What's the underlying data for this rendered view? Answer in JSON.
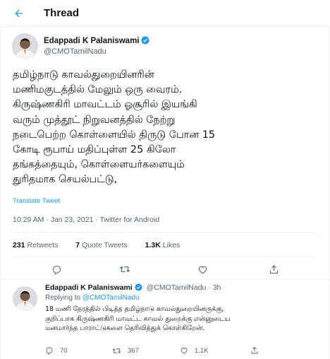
{
  "header": {
    "title": "Thread",
    "back_icon": "arrow-left-icon"
  },
  "accent_color": "#1d9bf0",
  "main_tweet": {
    "author_name": "Edappadi K Palaniswami",
    "author_handle": "@CMOTamilNadu",
    "verified": true,
    "text_lines": [
      "தமிழ்நாடு காவல்துறையினரின்",
      "மணிமகுடத்தில் மேலும் ஒரு வைரம்.",
      "கிருஷ்ணகிரி மாவட்டம் ஓசூரில் இயங்கி",
      "வரும் முத்தூட் நிறுவனத்தில் நேற்று",
      "நடைபெற்ற கொள்ளையில் திருடு போன 15",
      "கோடி ரூபாய் மதிப்புள்ள 25 கிலோ",
      "தங்கத்தையும், கொள்ளையர்களையும்",
      "துரிதமாக செயல்பட்டு,"
    ],
    "translate_label": "Translate Tweet",
    "timestamp": "10:29 AM · Jan 23, 2021 · Twitter for Android",
    "stats": {
      "retweets_count": "231",
      "retweets_label": "Retweets",
      "quotes_count": "7",
      "quotes_label": "Quote Tweets",
      "likes_count": "1.3K",
      "likes_label": "Likes"
    },
    "actions": [
      "reply-icon",
      "retweet-icon",
      "like-icon",
      "share-icon"
    ]
  },
  "reply_tweet": {
    "author_name": "Edappadi K Palaniswami",
    "author_handle_time": "@CMOTamilNadu · 3h",
    "verified": true,
    "replying_prefix": "Replying to",
    "replying_handle": "@CMOTamilNadu",
    "text_lines": [
      "18 மணி நேரத்தில் பிடித்த தமிழ்நாடு காவல்துறையினருக்கு,",
      "குறிப்பாக கிருஷ்ணகிரி மாவட்ட காவல் துறைக்கு என்னுடைய",
      "மனமார்ந்த பாராட்டுகளை தெரிவித்துக் கொள்கிறேன்."
    ],
    "reply_count": "70",
    "retweet_count": "367",
    "like_count": "1.1K"
  }
}
